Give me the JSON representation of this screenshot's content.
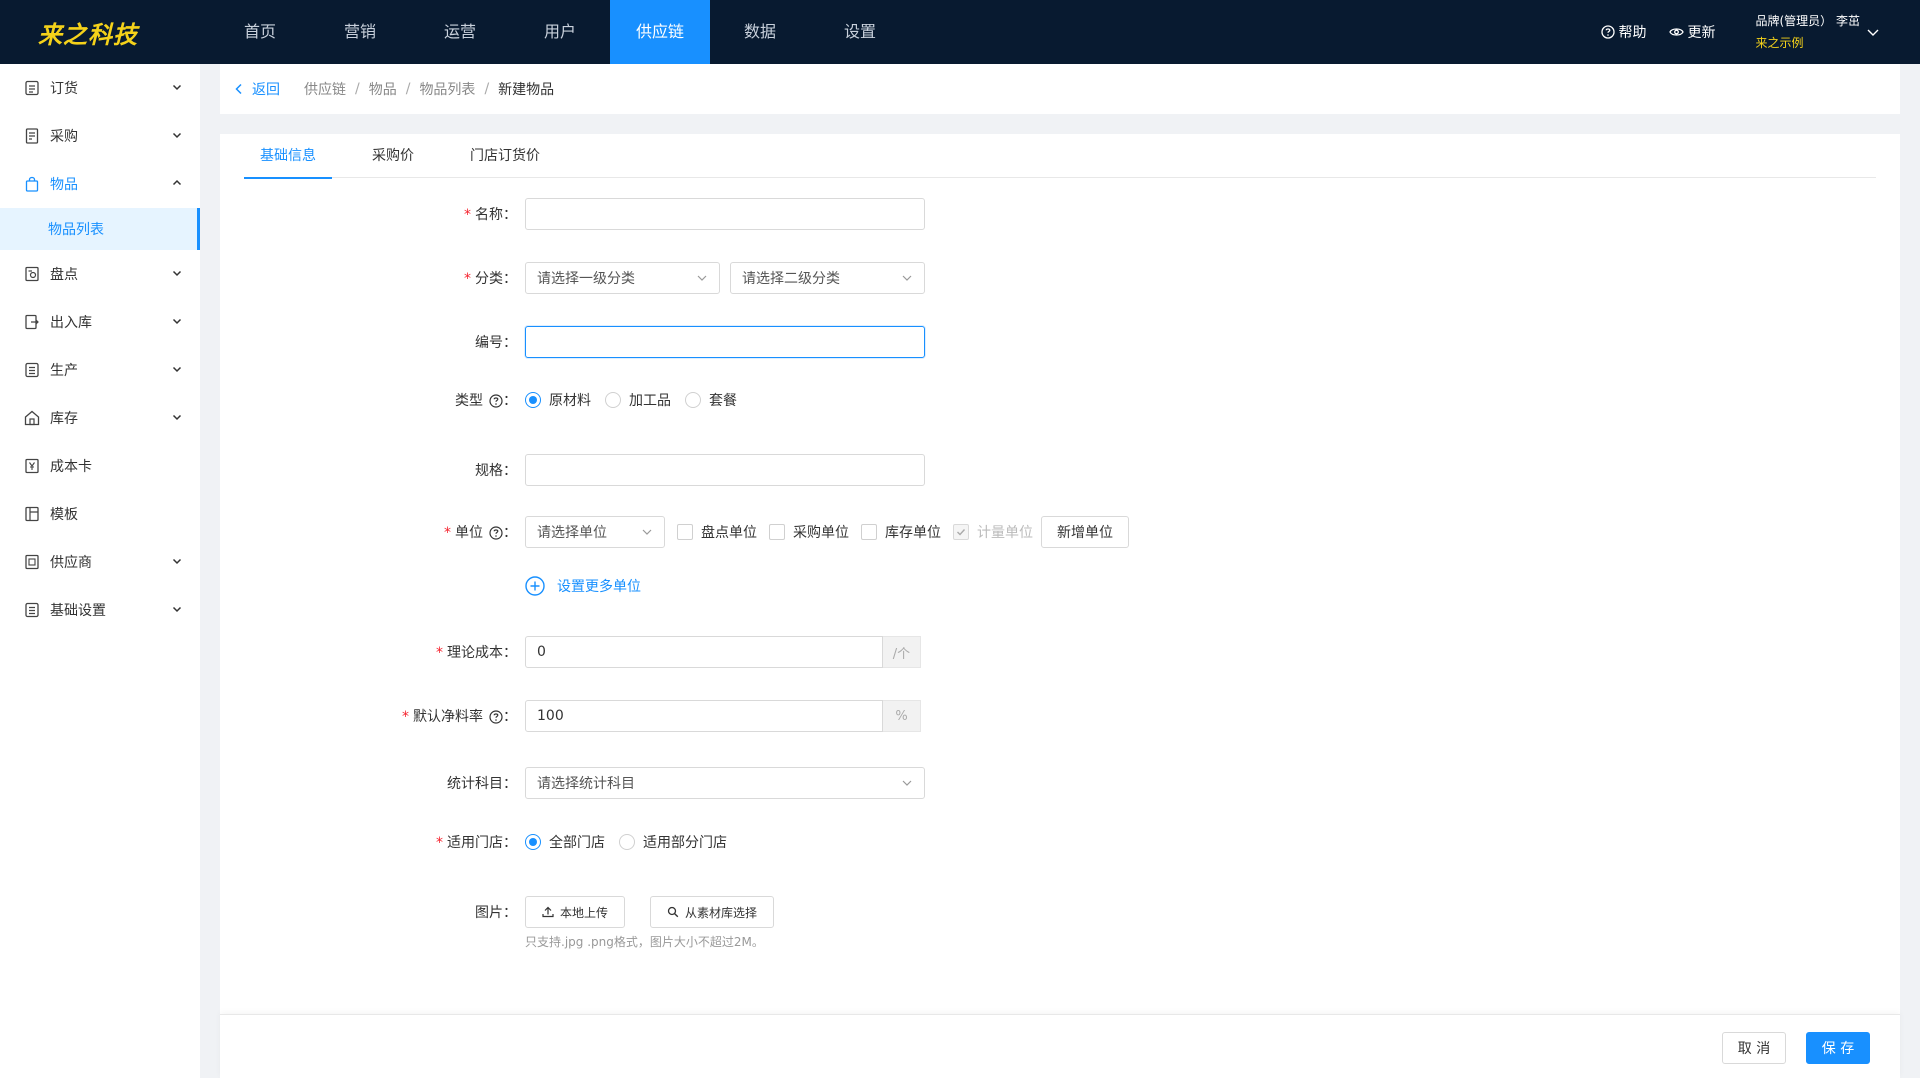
{
  "app": {
    "logo": "来之科技",
    "brand_color": "#f5d21a",
    "accent_color": "#1890ff",
    "nav_bg": "#081a30"
  },
  "topnav": {
    "items": [
      {
        "label": "首页",
        "active": false
      },
      {
        "label": "营销",
        "active": false
      },
      {
        "label": "运营",
        "active": false
      },
      {
        "label": "用户",
        "active": false
      },
      {
        "label": "供应链",
        "active": true
      },
      {
        "label": "数据",
        "active": false
      },
      {
        "label": "设置",
        "active": false
      }
    ],
    "help_label": "帮助",
    "update_label": "更新",
    "user_role": "品牌(管理员） 李茁",
    "user_org": "来之示例"
  },
  "sidebar": {
    "items": [
      {
        "label": "订货",
        "icon": "order-icon"
      },
      {
        "label": "采购",
        "icon": "purchase-icon"
      },
      {
        "label": "物品",
        "icon": "bag-icon"
      },
      {
        "label": "盘点",
        "icon": "inventory-count-icon"
      },
      {
        "label": "出入库",
        "icon": "warehouse-io-icon"
      },
      {
        "label": "生产",
        "icon": "production-icon"
      },
      {
        "label": "库存",
        "icon": "stock-icon"
      },
      {
        "label": "成本卡",
        "icon": "cost-card-icon"
      },
      {
        "label": "模板",
        "icon": "template-icon"
      },
      {
        "label": "供应商",
        "icon": "supplier-icon"
      },
      {
        "label": "基础设置",
        "icon": "settings-list-icon"
      }
    ],
    "active_sub": "物品列表"
  },
  "breadcrumb": {
    "back_label": "返回",
    "items": [
      "供应链",
      "物品",
      "物品列表",
      "新建物品"
    ]
  },
  "tabs": [
    {
      "label": "基础信息",
      "active": true
    },
    {
      "label": "采购价",
      "active": false
    },
    {
      "label": "门店订货价",
      "active": false
    }
  ],
  "form": {
    "name": {
      "label": "名称",
      "value": ""
    },
    "category": {
      "label": "分类",
      "level1_placeholder": "请选择一级分类",
      "level2_placeholder": "请选择二级分类"
    },
    "code": {
      "label": "编号",
      "value": ""
    },
    "type": {
      "label": "类型",
      "options": [
        "原材料",
        "加工品",
        "套餐"
      ],
      "selected": "原材料"
    },
    "spec": {
      "label": "规格",
      "value": ""
    },
    "unit": {
      "label": "单位",
      "placeholder": "请选择单位",
      "checks": [
        {
          "label": "盘点单位",
          "checked": false,
          "disabled": false
        },
        {
          "label": "采购单位",
          "checked": false,
          "disabled": false
        },
        {
          "label": "库存单位",
          "checked": false,
          "disabled": false
        },
        {
          "label": "计量单位",
          "checked": true,
          "disabled": true
        }
      ],
      "add_button": "新增单位",
      "more_units_link": "设置更多单位"
    },
    "cost": {
      "label": "理论成本",
      "value": "0",
      "suffix": "/个"
    },
    "net_rate": {
      "label": "默认净料率",
      "value": "100",
      "suffix": "%"
    },
    "subject": {
      "label": "统计科目",
      "placeholder": "请选择统计科目"
    },
    "stores": {
      "label": "适用门店",
      "options": [
        "全部门店",
        "适用部分门店"
      ],
      "selected": "全部门店"
    },
    "image": {
      "label": "图片",
      "upload_button": "本地上传",
      "library_button": "从素材库选择",
      "hint": "只支持.jpg .png格式，图片大小不超过2M。"
    }
  },
  "footer": {
    "cancel_label": "取 消",
    "save_label": "保 存"
  }
}
